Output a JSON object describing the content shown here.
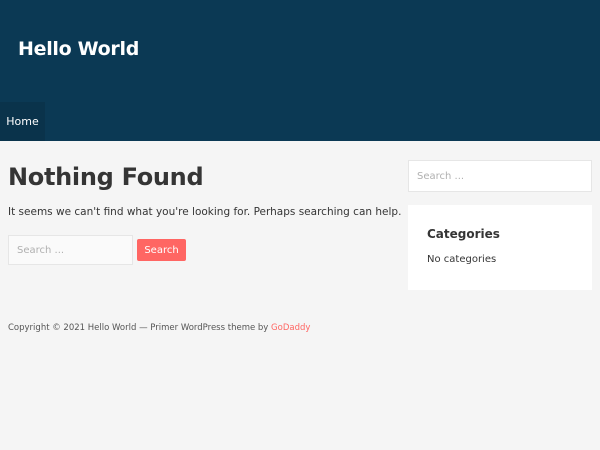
{
  "header": {
    "site_title": "Hello World",
    "nav": [
      {
        "label": "Home"
      }
    ]
  },
  "main": {
    "title": "Nothing Found",
    "description": "It seems we can't find what you're looking for. Perhaps searching can help.",
    "search": {
      "placeholder": "Search ...",
      "button_label": "Search"
    }
  },
  "sidebar": {
    "search": {
      "placeholder": "Search ..."
    },
    "categories_widget": {
      "title": "Categories",
      "body": "No categories"
    }
  },
  "footer": {
    "copyright": "Copyright © 2021 Hello World — Primer WordPress theme by ",
    "link_label": "GoDaddy"
  },
  "colors": {
    "header_bg": "#0b3954",
    "accent": "#ff6663",
    "page_bg": "#f5f5f5"
  }
}
